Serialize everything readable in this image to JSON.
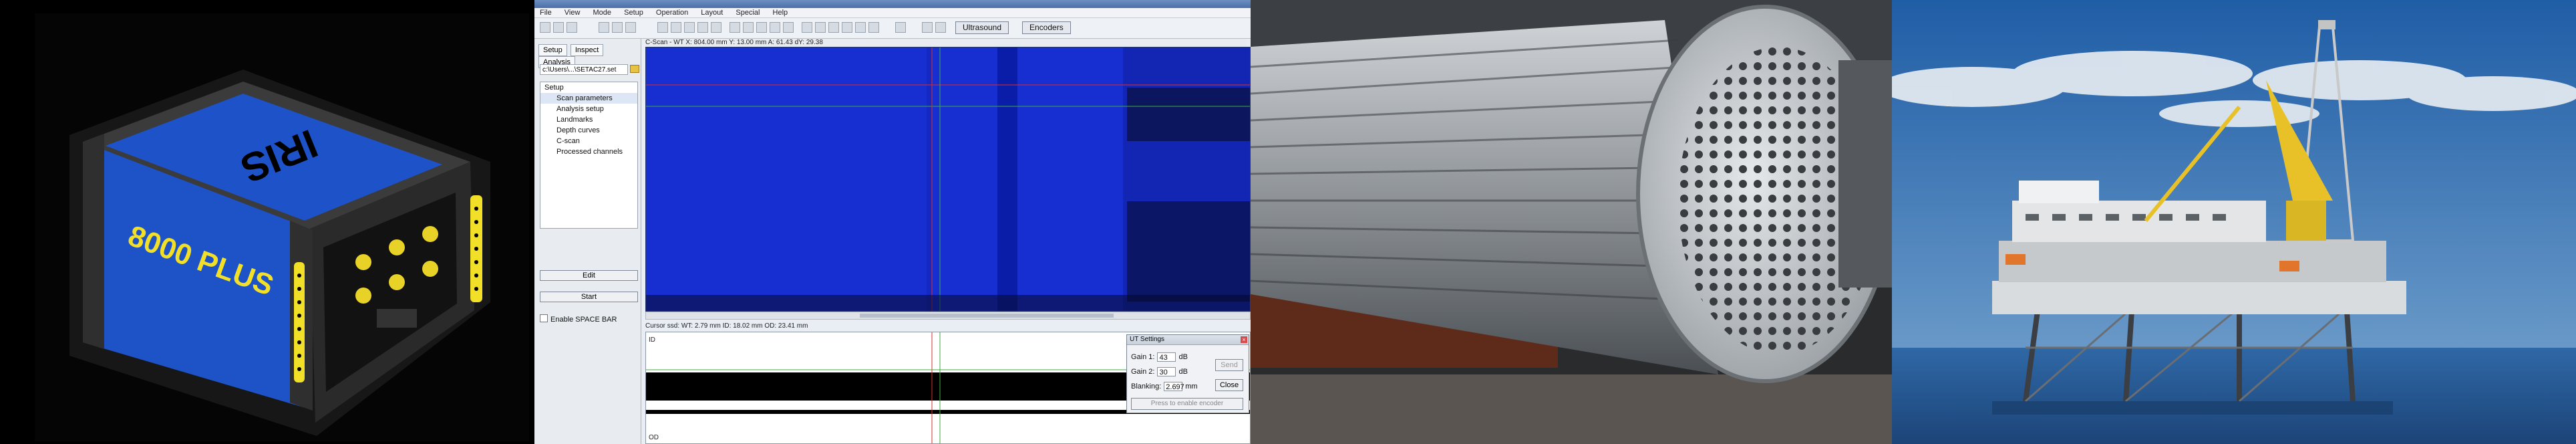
{
  "app": {
    "window_title": "",
    "menu": [
      "File",
      "View",
      "Mode",
      "Setup",
      "Operation",
      "Layout",
      "Special",
      "Help"
    ],
    "toolbar": {
      "mode_buttons": [
        "Ultrasound",
        "Encoders"
      ]
    },
    "left_panel": {
      "tabs": [
        "Setup",
        "Inspect",
        "Analysis"
      ],
      "setup_path": "c:\\Users\\...\\SETAC27.set",
      "tree_header": "Setup",
      "tree_items": [
        "Scan parameters",
        "Analysis setup",
        "Landmarks",
        "Depth curves",
        "C-scan",
        "Processed channels"
      ],
      "edit_button": "Edit",
      "start_button": "Start",
      "enable_spacebar_label": "Enable SPACE BAR"
    },
    "cscan_header": "C-Scan - WT  X: 804.00 mm  Y: 13.00 mm  A: 61.43  dY: 29.38",
    "cursor_info": "Cursor ssd: WT: 2.79 mm  ID: 18.02 mm  OD: 23.41 mm",
    "lower_labels": {
      "top": "ID",
      "bottom": "OD"
    },
    "ut_settings": {
      "title": "UT Settings",
      "gain1_label": "Gain 1:",
      "gain1_value": "43",
      "gain2_label": "Gain 2:",
      "gain2_value": "30",
      "db_unit": "dB",
      "blanking_label": "Blanking:",
      "blanking_value": "2.697",
      "mm_unit": "mm",
      "send_button": "Send",
      "close_button": "Close",
      "hint": "Press to enable encoder"
    }
  },
  "device": {
    "brand_text": "IRIS",
    "model_text": "8000 PLUS"
  },
  "colors": {
    "cscan_blue": "#1a33e3",
    "device_blue": "#1e54c8",
    "device_yellow": "#f2df28",
    "sea_blue": "#2f68a6"
  }
}
